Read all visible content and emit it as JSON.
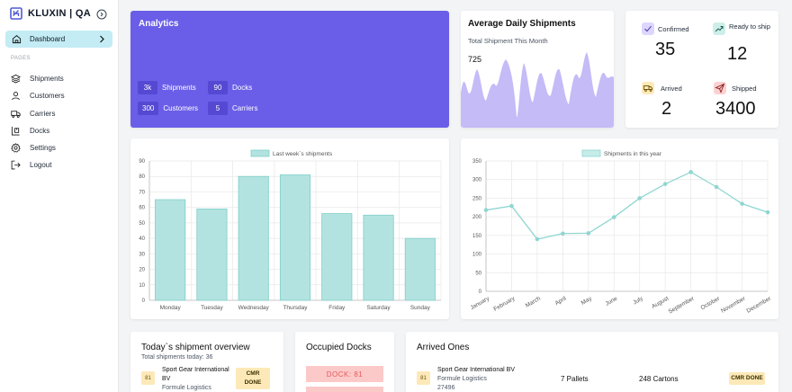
{
  "app": {
    "title": "KLUXIN | QA"
  },
  "sidebar": {
    "active": {
      "label": "Dashboard"
    },
    "section_label": "PAGES",
    "items": [
      {
        "label": "Shipments",
        "icon": "layers-icon"
      },
      {
        "label": "Customers",
        "icon": "user-icon"
      },
      {
        "label": "Carriers",
        "icon": "truck-icon"
      },
      {
        "label": "Docks",
        "icon": "docks-icon"
      },
      {
        "label": "Settings",
        "icon": "gear-icon"
      },
      {
        "label": "Logout",
        "icon": "logout-icon"
      }
    ]
  },
  "analytics": {
    "title": "Analytics",
    "stats": [
      {
        "value": "3k",
        "label": "Shipments"
      },
      {
        "value": "90",
        "label": "Docks"
      },
      {
        "value": "300",
        "label": "Customers"
      },
      {
        "value": "5",
        "label": "Carriers"
      }
    ]
  },
  "avg_daily": {
    "title": "Average Daily Shipments",
    "subtitle": "Total Shipment This Month",
    "value": "725"
  },
  "status": {
    "confirmed": {
      "label": "Confirmed",
      "value": "35",
      "color": "#ddd6fe"
    },
    "ready": {
      "label": "Ready to ship",
      "value": "12",
      "color": "#cdeee9"
    },
    "arrived": {
      "label": "Arrived",
      "value": "2",
      "color": "#fde9b8"
    },
    "shipped": {
      "label": "Shipped",
      "value": "3400",
      "color": "#fcd1d1"
    }
  },
  "chart_data": [
    {
      "type": "bar",
      "legend": "Last week`s shipments",
      "categories": [
        "Monday",
        "Tuesday",
        "Wednesday",
        "Thursday",
        "Friday",
        "Saturday",
        "Sunday"
      ],
      "values": [
        65,
        59,
        80,
        81,
        56,
        55,
        40
      ],
      "ylim": [
        0,
        90
      ],
      "yticks": [
        "0",
        "10",
        "20",
        "30",
        "40",
        "50",
        "60",
        "70",
        "80",
        "90"
      ],
      "grid": true,
      "legend_position": "top",
      "fill_color": "#b3e3e0",
      "stroke_color": "#7fcfc9"
    },
    {
      "type": "line",
      "legend": "Shipments in this year",
      "categories": [
        "January",
        "February",
        "March",
        "April",
        "May",
        "June",
        "July",
        "August",
        "September",
        "October",
        "November",
        "December"
      ],
      "values": [
        218,
        229,
        140,
        155,
        156,
        199,
        250,
        288,
        320,
        280,
        235,
        212
      ],
      "ylim": [
        0,
        350
      ],
      "yticks": [
        "0",
        "50",
        "100",
        "150",
        "200",
        "250",
        "300",
        "350"
      ],
      "grid": true,
      "legend_position": "top",
      "line_color": "#8fd6d1"
    }
  ],
  "today": {
    "title": "Today`s shipment overview",
    "subtitle": "Total shipments today: 36",
    "badge": "81",
    "company_line1": "Sport Gear International",
    "company_line2": "BV",
    "company_sub": "Formule Logistics",
    "cmr_line1": "CMR",
    "cmr_line2": "DONE"
  },
  "docks": {
    "title": "Occupied Docks",
    "chip": "DOCK: 81"
  },
  "arrived_ones": {
    "title": "Arrived Ones",
    "badge": "81",
    "company": "Sport Gear International BV",
    "company_sub1": "Formule Logistics",
    "company_sub2": "27496",
    "pallets": "7 Pallets",
    "cartons": "248 Cartons",
    "cmr": "CMR DONE"
  }
}
